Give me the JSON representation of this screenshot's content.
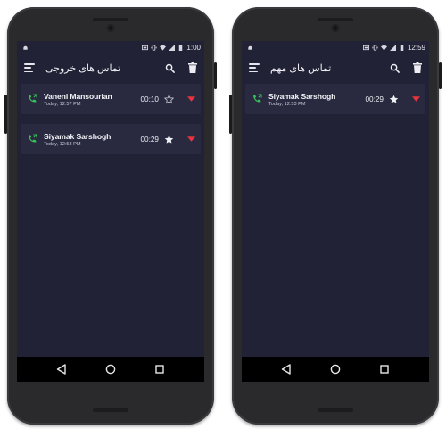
{
  "screens": [
    {
      "status": {
        "time": "1:00"
      },
      "title": "تماس های خروجی",
      "calls": [
        {
          "name": "Vaneni Mansourian",
          "timestamp": "Today, 12:57 PM",
          "duration": "00:10",
          "starred": false
        },
        {
          "name": "Siyamak Sarshogh",
          "timestamp": "Today, 12:53 PM",
          "duration": "00:29",
          "starred": true
        }
      ]
    },
    {
      "status": {
        "time": "12:59"
      },
      "title": "تماس های مهم",
      "calls": [
        {
          "name": "Siyamak Sarshogh",
          "timestamp": "Today, 12:53 PM",
          "duration": "00:29",
          "starred": true
        }
      ]
    }
  ],
  "icons": {
    "menu": "menu-icon",
    "search": "search-icon",
    "delete": "trash-icon",
    "call": "outgoing-call-icon",
    "star": "star-icon",
    "expand": "dropdown-arrow-icon",
    "back": "back-icon",
    "home": "home-icon",
    "recents": "recents-icon"
  },
  "colors": {
    "screen_bg": "#222236",
    "row_bg": "#292a40",
    "call_icon": "#36c25a",
    "expand_arrow": "#e8343e",
    "nav_bar": "#000000"
  }
}
